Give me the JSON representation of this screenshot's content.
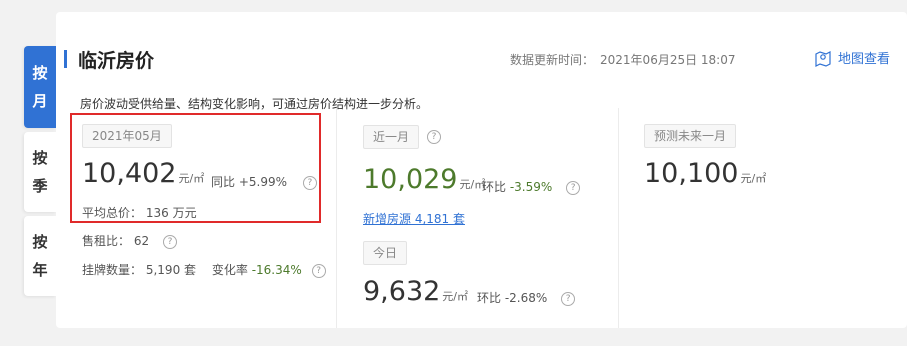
{
  "tabs": [
    {
      "chars": [
        "按",
        "月"
      ],
      "active": true
    },
    {
      "chars": [
        "按",
        "季"
      ],
      "active": false
    },
    {
      "chars": [
        "按",
        "年"
      ],
      "active": false
    }
  ],
  "header": {
    "title": "临沂房价",
    "update_label": "数据更新时间：",
    "update_time": "2021年06月25日 18:07",
    "map_link": "地图查看"
  },
  "description": "房价波动受供给量、结构变化影响，可通过房价结构进一步分析。",
  "month": {
    "chip": "2021年05月",
    "price": "10,402",
    "unit": "元/㎡",
    "yoy_label": "同比",
    "yoy_value": "+5.99%",
    "total_label": "平均总价：",
    "total_value": "136 万元",
    "rent_label": "售租比：",
    "rent_value": "62",
    "listing_label": "挂牌数量：",
    "listing_value": "5,190 套",
    "change_label": "变化率",
    "change_value": "-16.34%"
  },
  "recent": {
    "chip": "近一月",
    "price": "10,029",
    "unit": "元/㎡",
    "mom_label": "环比",
    "mom_value": "-3.59%",
    "new_listings": "新增房源 4,181 套"
  },
  "today": {
    "chip": "今日",
    "price": "9,632",
    "unit": "元/㎡",
    "mom_label": "环比",
    "mom_value": "-2.68%"
  },
  "forecast": {
    "chip": "预测未来一月",
    "price": "10,100",
    "unit": "元/㎡"
  },
  "colors": {
    "accent": "#3072d4",
    "negative": "#4d7a2c",
    "highlight": "#e02a2a"
  }
}
